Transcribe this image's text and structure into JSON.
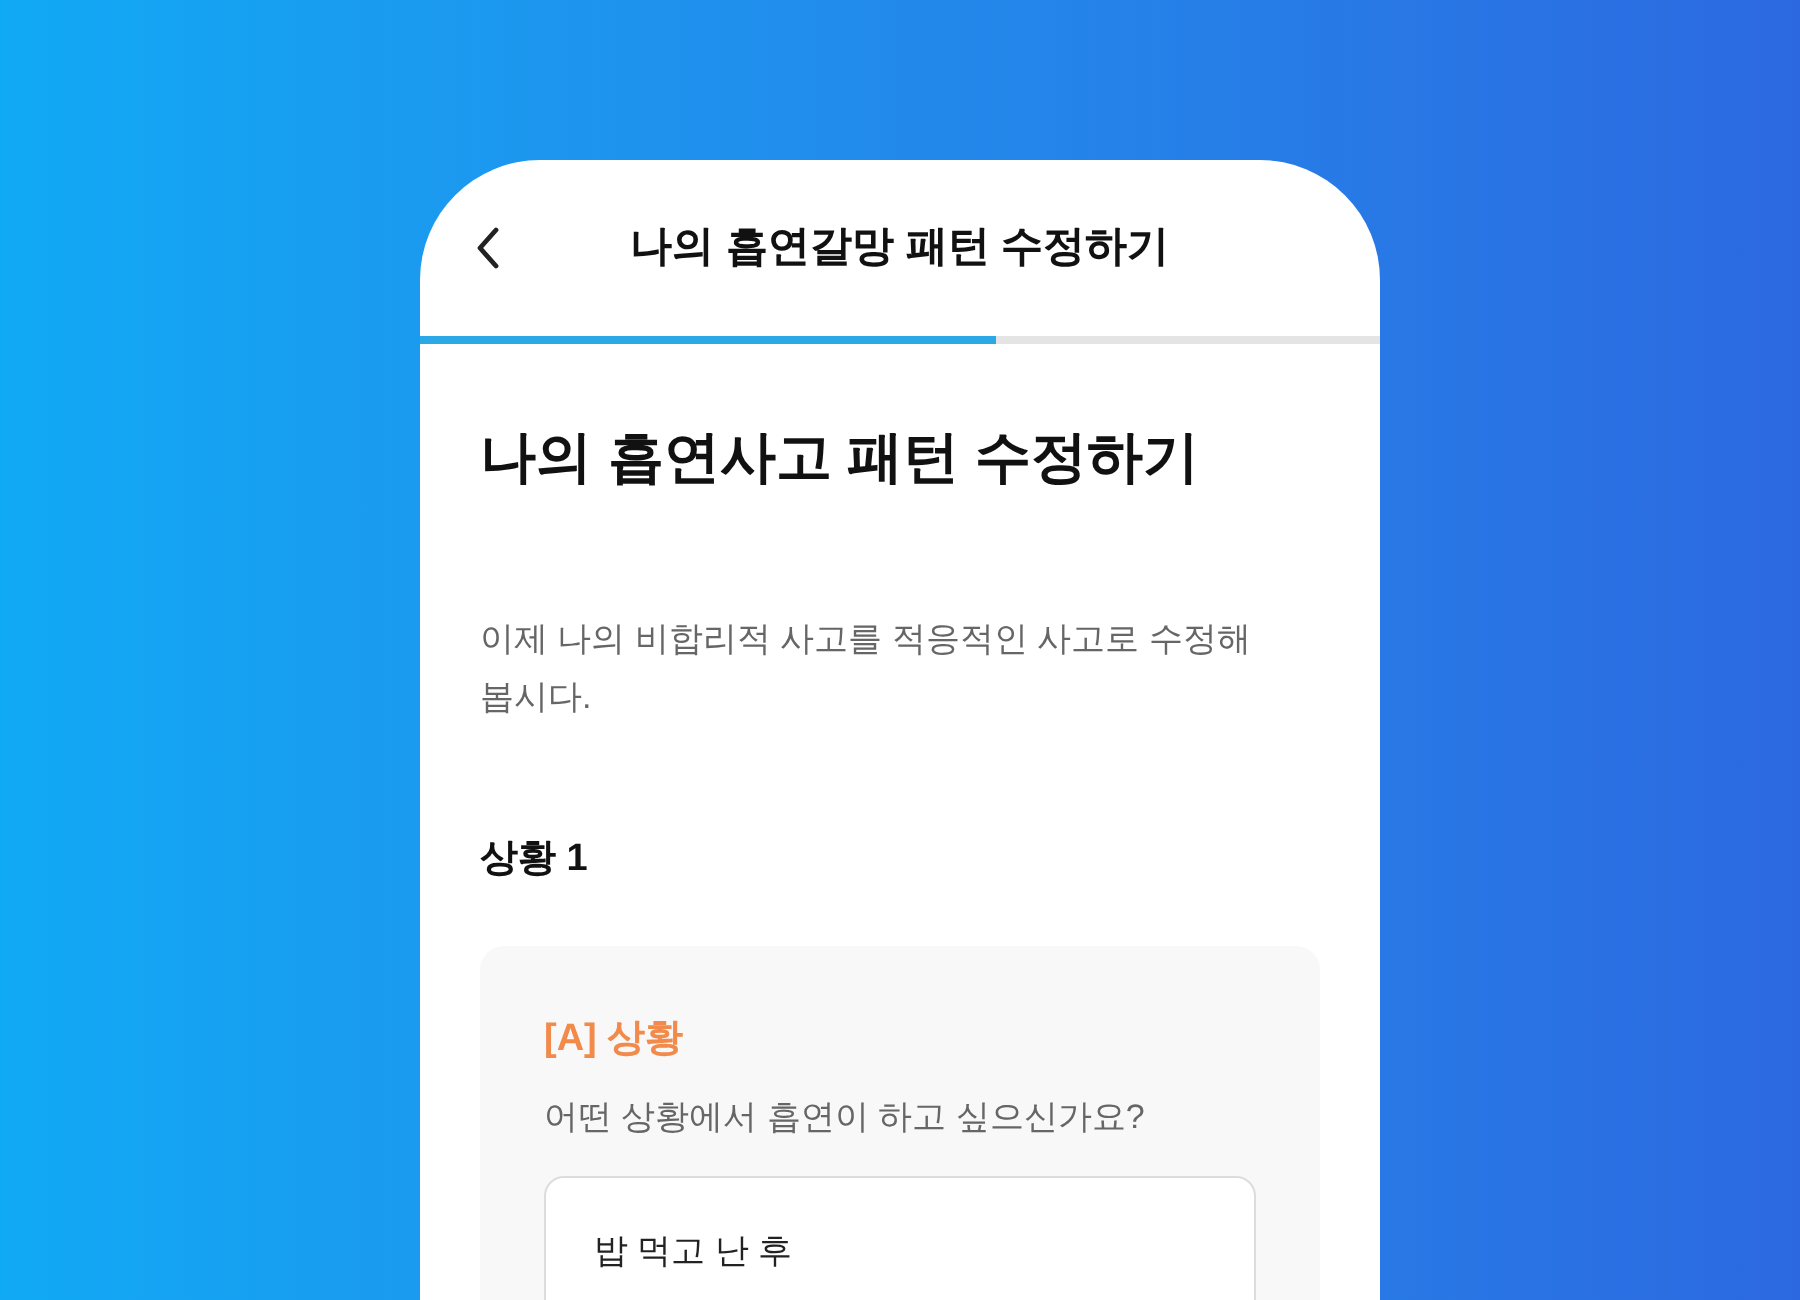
{
  "header": {
    "title": "나의 흡연갈망 패턴 수정하기"
  },
  "progress": {
    "level": 0.6
  },
  "page_title": "나의 흡연사고 패턴 수정하기",
  "description": "이제 나의 비합리적 사고를 적응적인 사고로 수정해봅시다.",
  "section_title": "상황 1",
  "card": {
    "label": "[A] 상황",
    "question": "어떤 상황에서 흡연이 하고 싶으신가요?",
    "answer": "밥 먹고 난 후"
  }
}
